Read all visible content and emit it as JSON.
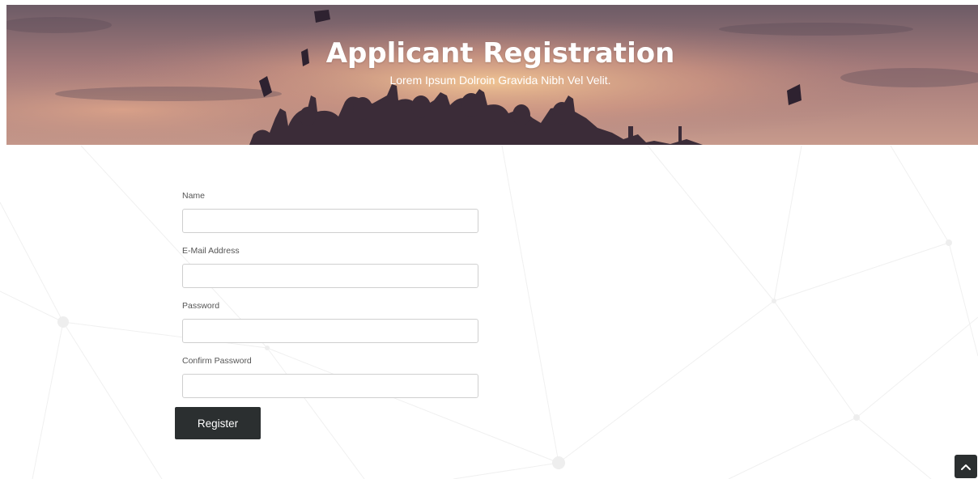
{
  "hero": {
    "title": "Applicant Registration",
    "subtitle": "Lorem Ipsum Dolroin Gravida Nibh Vel Velit."
  },
  "form": {
    "fields": [
      {
        "label": "Name",
        "value": "",
        "type": "text"
      },
      {
        "label": "E-Mail Address",
        "value": "",
        "type": "email"
      },
      {
        "label": "Password",
        "value": "",
        "type": "password"
      },
      {
        "label": "Confirm Password",
        "value": "",
        "type": "password"
      }
    ],
    "submit_label": "Register"
  },
  "scroll_top": {
    "icon": "chevron-up-icon"
  },
  "colors": {
    "button_bg": "#2b2f30",
    "input_border": "#cfcfcf",
    "label_text": "#555555",
    "hero_sky_top": "#6c5b66",
    "hero_sky_glow": "#e9b98a"
  }
}
